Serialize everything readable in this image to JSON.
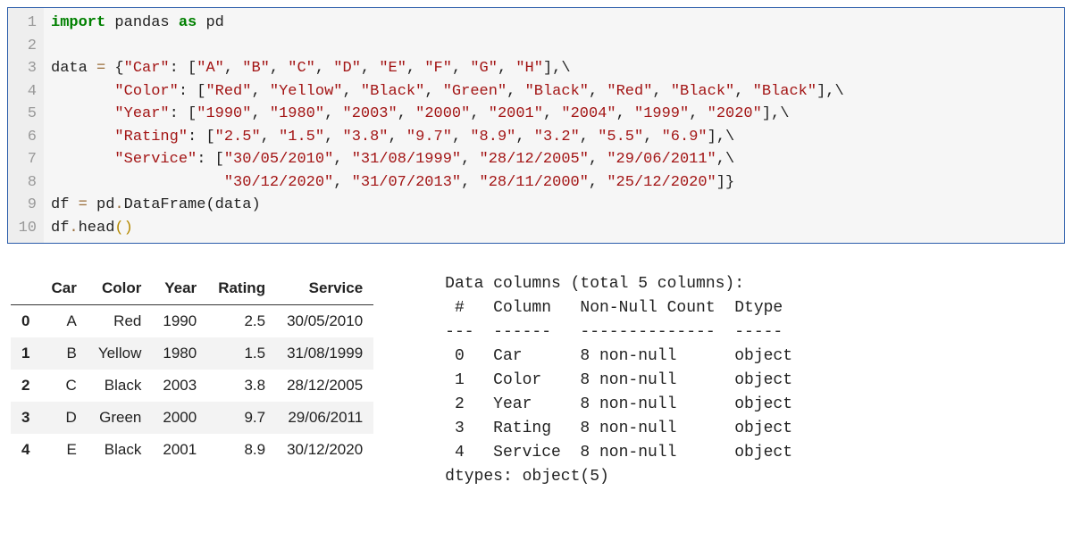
{
  "code": {
    "line_count": 10,
    "lines": {
      "l1": {
        "import": "import",
        "pkg": "pandas",
        "as": "as",
        "alias": "pd"
      },
      "l3": {
        "var": "data",
        "eq": "=",
        "open": "{",
        "key": "\"Car\"",
        "colon": ":",
        "br_open": "[",
        "vals": [
          "\"A\"",
          "\"B\"",
          "\"C\"",
          "\"D\"",
          "\"E\"",
          "\"F\"",
          "\"G\"",
          "\"H\""
        ],
        "br_close": "]",
        "comma": ",",
        "bslash": "\\"
      },
      "l4": {
        "indent": "       ",
        "key": "\"Color\"",
        "colon": ":",
        "br_open": "[",
        "vals": [
          "\"Red\"",
          "\"Yellow\"",
          "\"Black\"",
          "\"Green\"",
          "\"Black\"",
          "\"Red\"",
          "\"Black\"",
          "\"Black\""
        ],
        "br_close": "]",
        "comma": ",",
        "bslash": "\\"
      },
      "l5": {
        "indent": "       ",
        "key": "\"Year\"",
        "colon": ":",
        "br_open": "[",
        "vals": [
          "\"1990\"",
          "\"1980\"",
          "\"2003\"",
          "\"2000\"",
          "\"2001\"",
          "\"2004\"",
          "\"1999\"",
          "\"2020\""
        ],
        "br_close": "]",
        "comma": ",",
        "bslash": "\\"
      },
      "l6": {
        "indent": "       ",
        "key": "\"Rating\"",
        "colon": ":",
        "br_open": "[",
        "vals": [
          "\"2.5\"",
          "\"1.5\"",
          "\"3.8\"",
          "\"9.7\"",
          "\"8.9\"",
          "\"3.2\"",
          "\"5.5\"",
          "\"6.9\""
        ],
        "br_close": "]",
        "comma": ",",
        "bslash": "\\"
      },
      "l7": {
        "indent": "       ",
        "key": "\"Service\"",
        "colon": ":",
        "br_open": "[",
        "vals_a": [
          "\"30/05/2010\"",
          "\"31/08/1999\"",
          "\"28/12/2005\"",
          "\"29/06/2011\""
        ],
        "comma": ",",
        "bslash": "\\"
      },
      "l8": {
        "indent": "                   ",
        "vals_b": [
          "\"30/12/2020\"",
          "\"31/07/2013\"",
          "\"28/11/2000\"",
          "\"25/12/2020\""
        ],
        "br_close": "]",
        "close_brace": "}"
      },
      "l9": {
        "var": "df",
        "eq": "=",
        "expr1": "pd",
        "dot1": ".",
        "fn": "DataFrame",
        "po": "(",
        "arg": "data",
        "pc": ")"
      },
      "l10": {
        "expr1": "df",
        "dot": ".",
        "fn": "head",
        "po": "(",
        "pc": ")"
      }
    }
  },
  "table": {
    "columns": [
      "Car",
      "Color",
      "Year",
      "Rating",
      "Service"
    ],
    "rows": [
      {
        "idx": "0",
        "cells": [
          "A",
          "Red",
          "1990",
          "2.5",
          "30/05/2010"
        ]
      },
      {
        "idx": "1",
        "cells": [
          "B",
          "Yellow",
          "1980",
          "1.5",
          "31/08/1999"
        ]
      },
      {
        "idx": "2",
        "cells": [
          "C",
          "Black",
          "2003",
          "3.8",
          "28/12/2005"
        ]
      },
      {
        "idx": "3",
        "cells": [
          "D",
          "Green",
          "2000",
          "9.7",
          "29/06/2011"
        ]
      },
      {
        "idx": "4",
        "cells": [
          "E",
          "Black",
          "2001",
          "8.9",
          "30/12/2020"
        ]
      }
    ]
  },
  "info": {
    "header": "Data columns (total 5 columns):",
    "cols_header": " #   Column   Non-Null Count  Dtype ",
    "sep": "---  ------   --------------  ----- ",
    "rows": [
      " 0   Car      8 non-null      object",
      " 1   Color    8 non-null      object",
      " 2   Year     8 non-null      object",
      " 3   Rating   8 non-null      object",
      " 4   Service  8 non-null      object"
    ],
    "footer": "dtypes: object(5)"
  }
}
